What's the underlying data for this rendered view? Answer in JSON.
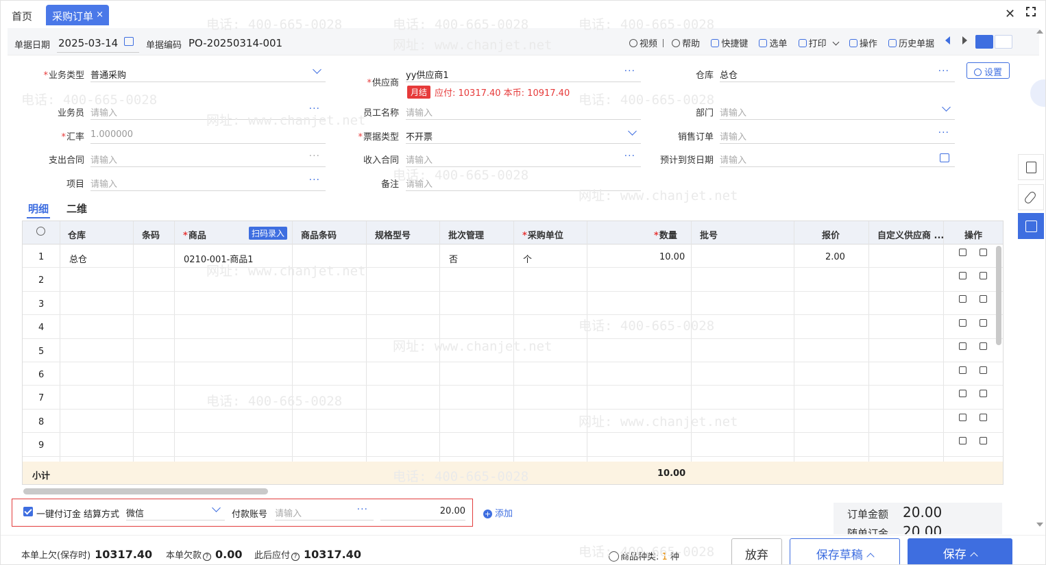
{
  "tabs": {
    "home": "首页",
    "active": "采购订单",
    "close": "×"
  },
  "header": {
    "date_label": "单据日期",
    "date_value": "2025-03-14",
    "code_label": "单据编码",
    "code_value": "PO-20250314-001",
    "tools": [
      "视频",
      "帮助",
      "快捷键",
      "选单",
      "打印",
      "操作",
      "历史单据"
    ]
  },
  "form": {
    "business_type": {
      "label": "业务类型",
      "value": "普通采购"
    },
    "supplier": {
      "label": "供应商",
      "value": "yy供应商1",
      "badge": "月结",
      "due": "应付: 10317.40  本币: 10917.40"
    },
    "warehouse": {
      "label": "仓库",
      "value": "总仓"
    },
    "settings": "设置",
    "salesman": {
      "label": "业务员",
      "placeholder": "请输入"
    },
    "employee": {
      "label": "员工名称",
      "placeholder": "请输入"
    },
    "department": {
      "label": "部门",
      "placeholder": "请输入"
    },
    "exchange_rate": {
      "label": "汇率",
      "value": "1.000000"
    },
    "invoice_type": {
      "label": "票据类型",
      "value": "不开票"
    },
    "sales_order": {
      "label": "销售订单",
      "placeholder": "请输入"
    },
    "expense_contract": {
      "label": "支出合同",
      "placeholder": "请输入"
    },
    "income_contract": {
      "label": "收入合同",
      "placeholder": "请输入"
    },
    "expected_date": {
      "label": "预计到货日期",
      "placeholder": "请输入"
    },
    "project": {
      "label": "项目",
      "placeholder": "请输入"
    },
    "remark": {
      "label": "备注",
      "placeholder": "请输入"
    }
  },
  "subtabs": [
    "明细",
    "二维"
  ],
  "table": {
    "columns": [
      "仓库",
      "条码",
      "商品",
      "商品条码",
      "规格型号",
      "批次管理",
      "采购单位",
      "数量",
      "批号",
      "报价",
      "自定义供应商 ...",
      "操作"
    ],
    "scan_button": "扫码录入",
    "rows": [
      {
        "no": "1",
        "warehouse": "总仓",
        "product": "0210-001-商品1",
        "batch": "否",
        "unit": "个",
        "qty": "10.00",
        "price": "2.00"
      },
      {
        "no": "2"
      },
      {
        "no": "3"
      },
      {
        "no": "4"
      },
      {
        "no": "5"
      },
      {
        "no": "6"
      },
      {
        "no": "7"
      },
      {
        "no": "8"
      },
      {
        "no": "9"
      }
    ],
    "subtotal_label": "小计",
    "subtotal_qty": "10.00"
  },
  "payment": {
    "checkbox_label": "一键付订金",
    "method_label": "结算方式",
    "method_value": "微信",
    "account_label": "付款账号",
    "account_placeholder": "请输入",
    "amount": "20.00",
    "add": "添加"
  },
  "summary": {
    "order_amount_label": "订单金额",
    "order_amount": "20.00",
    "deposit_label": "随单订金",
    "deposit": "20.00"
  },
  "footer": {
    "prev_debt_label": "本单上欠(保存时)",
    "prev_debt": "10317.40",
    "current_debt_label": "本单欠款",
    "current_debt": "0.00",
    "after_payable_label": "此后应付",
    "after_payable": "10317.40",
    "kinds_label": "商品种类:",
    "kinds_value": "1",
    "kinds_unit": "种",
    "discard": "放弃",
    "save_draft": "保存草稿",
    "save": "保存"
  },
  "watermark": {
    "phone": "电话: 400-665-0028",
    "site": "网址: www.chanjet.net"
  },
  "colors": {
    "accent": "#3e6ee0",
    "danger": "#e63a3a",
    "subtotal_bg": "#fcf3e2"
  }
}
